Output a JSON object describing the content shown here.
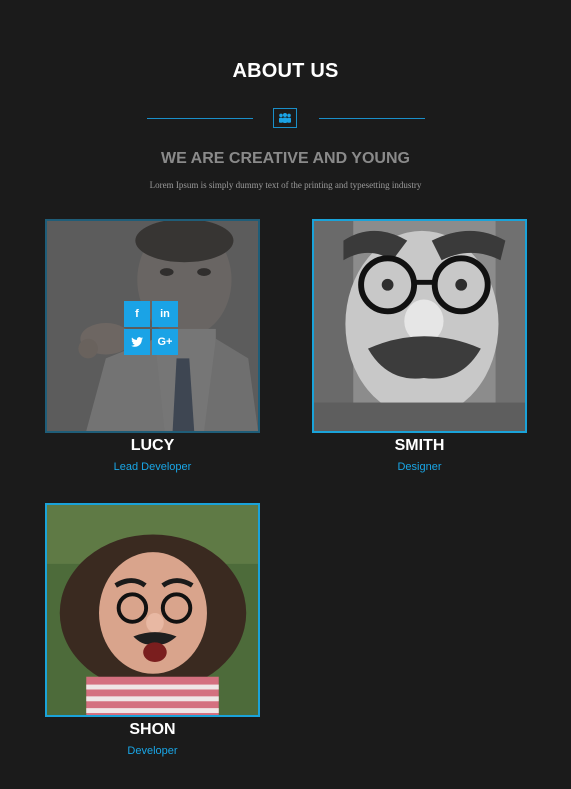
{
  "section": {
    "title": "ABOUT US",
    "divider_icon": "team-icon",
    "subtitle": "WE ARE CREATIVE AND YOUNG",
    "description": "Lorem Ipsum is simply dummy text of the printing and typesetting industry"
  },
  "team": [
    {
      "name": "LUCY",
      "role": "Lead Developer",
      "photo": "man-with-glasses-photo",
      "social": {
        "facebook": "f",
        "linkedin": "in",
        "twitter": "t",
        "googleplus": "G+"
      }
    },
    {
      "name": "SMITH",
      "role": "Designer",
      "photo": "man-with-fake-nose-glasses-photo"
    },
    {
      "name": "SHON",
      "role": "Developer",
      "photo": "woman-with-fake-nose-glasses-photo"
    }
  ],
  "colors": {
    "background": "#1b1b1b",
    "accent": "#1aa3e6",
    "title": "#ffffff",
    "subtitle": "#8a8a8a"
  }
}
